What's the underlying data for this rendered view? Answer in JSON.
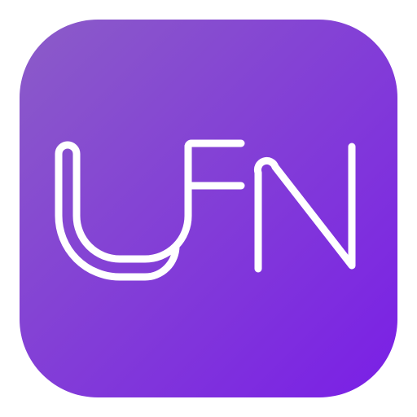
{
  "logo": {
    "text": "UFN",
    "icon": "ufn-monogram-icon"
  },
  "colors": {
    "gradient_start": "#8B5CC8",
    "gradient_end": "#7A1FE6",
    "stroke": "#FFFFFF",
    "background": "#FFFFFF"
  }
}
